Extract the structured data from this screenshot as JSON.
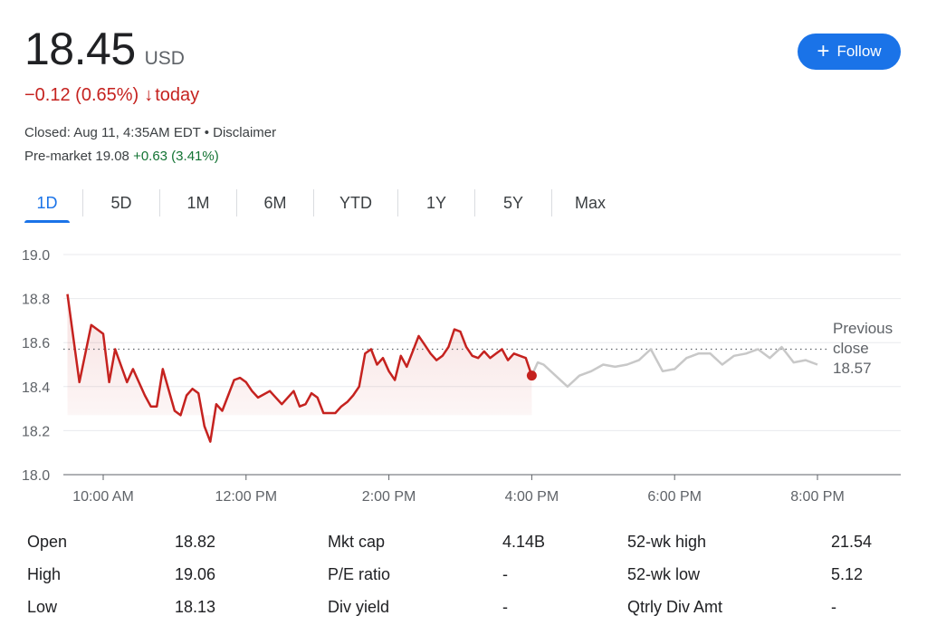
{
  "quote": {
    "price": "18.45",
    "currency": "USD",
    "change": "−0.12 (0.65%)",
    "change_arrow": "↓",
    "change_period": "today",
    "closed_text": "Closed: Aug 11, 4:35AM EDT • Disclaimer",
    "premarket_label": "Pre-market 19.08",
    "premarket_change": "+0.63 (3.41%)"
  },
  "follow_button": {
    "icon": "plus-icon",
    "label": "Follow"
  },
  "tabs": [
    {
      "label": "1D",
      "active": true
    },
    {
      "label": "5D",
      "active": false
    },
    {
      "label": "1M",
      "active": false
    },
    {
      "label": "6M",
      "active": false
    },
    {
      "label": "YTD",
      "active": false
    },
    {
      "label": "1Y",
      "active": false
    },
    {
      "label": "5Y",
      "active": false
    },
    {
      "label": "Max",
      "active": false
    }
  ],
  "colors": {
    "down": "#c5221f",
    "up": "#137333",
    "accent": "#1a73e8",
    "extended": "#c8c8c8",
    "grid": "#e8eaed"
  },
  "chart_data": {
    "type": "line",
    "ylim": [
      18.0,
      19.0
    ],
    "yticks": [
      "19.0",
      "18.8",
      "18.6",
      "18.4",
      "18.2",
      "18.0"
    ],
    "xticks": [
      "10:00 AM",
      "12:00 PM",
      "2:00 PM",
      "4:00 PM",
      "6:00 PM",
      "8:00 PM"
    ],
    "previous_close": 18.57,
    "previous_close_label": [
      "Previous",
      "close",
      "18.57"
    ],
    "series": [
      {
        "session": "regular",
        "x": [
          "9:30 AM",
          "9:40 AM",
          "9:50 AM",
          "10:00 AM",
          "10:05 AM",
          "10:10 AM",
          "10:20 AM",
          "10:25 AM",
          "10:35 AM",
          "10:40 AM",
          "10:45 AM",
          "10:50 AM",
          "11:00 AM",
          "11:05 AM",
          "11:10 AM",
          "11:15 AM",
          "11:20 AM",
          "11:25 AM",
          "11:30 AM",
          "11:35 AM",
          "11:40 AM",
          "11:50 AM",
          "11:55 AM",
          "12:00 PM",
          "12:05 PM",
          "12:10 PM",
          "12:20 PM",
          "12:30 PM",
          "12:40 PM",
          "12:45 PM",
          "12:50 PM",
          "12:55 PM",
          "1:00 PM",
          "1:05 PM",
          "1:10 PM",
          "1:15 PM",
          "1:20 PM",
          "1:25 PM",
          "1:30 PM",
          "1:35 PM",
          "1:40 PM",
          "1:45 PM",
          "1:50 PM",
          "1:55 PM",
          "2:00 PM",
          "2:05 PM",
          "2:10 PM",
          "2:15 PM",
          "2:20 PM",
          "2:25 PM",
          "2:30 PM",
          "2:35 PM",
          "2:40 PM",
          "2:45 PM",
          "2:50 PM",
          "2:55 PM",
          "3:00 PM",
          "3:05 PM",
          "3:10 PM",
          "3:15 PM",
          "3:20 PM",
          "3:25 PM",
          "3:30 PM",
          "3:35 PM",
          "3:40 PM",
          "3:45 PM",
          "3:50 PM",
          "3:55 PM",
          "4:00 PM"
        ],
        "y": [
          18.82,
          18.42,
          18.68,
          18.64,
          18.42,
          18.57,
          18.42,
          18.48,
          18.36,
          18.31,
          18.31,
          18.48,
          18.29,
          18.27,
          18.36,
          18.39,
          18.37,
          18.22,
          18.15,
          18.32,
          18.29,
          18.43,
          18.44,
          18.42,
          18.38,
          18.35,
          18.38,
          18.32,
          18.38,
          18.31,
          18.32,
          18.37,
          18.35,
          18.28,
          18.28,
          18.28,
          18.31,
          18.33,
          18.36,
          18.4,
          18.55,
          18.57,
          18.5,
          18.53,
          18.47,
          18.43,
          18.54,
          18.49,
          18.56,
          18.63,
          18.59,
          18.55,
          18.52,
          18.54,
          18.58,
          18.66,
          18.65,
          18.58,
          18.54,
          18.53,
          18.56,
          18.53,
          18.55,
          18.57,
          18.52,
          18.55,
          18.54,
          18.53,
          18.45
        ]
      },
      {
        "session": "after-hours",
        "x": [
          "4:00 PM",
          "4:05 PM",
          "4:10 PM",
          "4:20 PM",
          "4:30 PM",
          "4:40 PM",
          "4:50 PM",
          "5:00 PM",
          "5:10 PM",
          "5:20 PM",
          "5:30 PM",
          "5:40 PM",
          "5:50 PM",
          "6:00 PM",
          "6:10 PM",
          "6:20 PM",
          "6:30 PM",
          "6:40 PM",
          "6:50 PM",
          "7:00 PM",
          "7:10 PM",
          "7:20 PM",
          "7:30 PM",
          "7:40 PM",
          "7:50 PM",
          "8:00 PM"
        ],
        "y": [
          18.45,
          18.51,
          18.5,
          18.45,
          18.4,
          18.45,
          18.47,
          18.5,
          18.49,
          18.5,
          18.52,
          18.57,
          18.47,
          18.48,
          18.53,
          18.55,
          18.55,
          18.5,
          18.54,
          18.55,
          18.57,
          18.53,
          18.58,
          18.51,
          18.52,
          18.5
        ]
      }
    ]
  },
  "stats": [
    [
      {
        "label": "Open",
        "value": "18.82"
      },
      {
        "label": "High",
        "value": "19.06"
      },
      {
        "label": "Low",
        "value": "18.13"
      }
    ],
    [
      {
        "label": "Mkt cap",
        "value": "4.14B"
      },
      {
        "label": "P/E ratio",
        "value": "-"
      },
      {
        "label": "Div yield",
        "value": "-"
      }
    ],
    [
      {
        "label": "52-wk high",
        "value": "21.54"
      },
      {
        "label": "52-wk low",
        "value": "5.12"
      },
      {
        "label": "Qtrly Div Amt",
        "value": "-"
      }
    ]
  ]
}
